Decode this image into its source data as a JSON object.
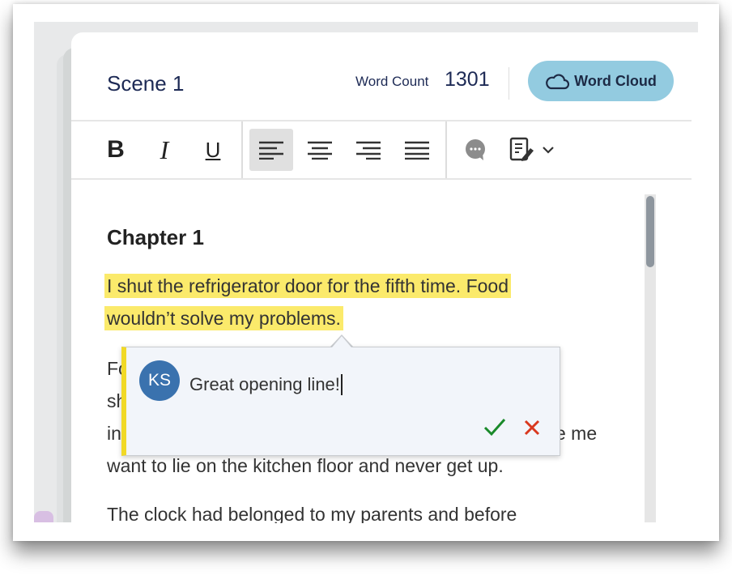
{
  "header": {
    "title": "Scene 1",
    "word_count_label": "Word Count",
    "word_count": "1301",
    "word_cloud_button": "Word Cloud"
  },
  "toolbar": {
    "buttons": [
      "bold-icon",
      "italic-icon",
      "underline-icon",
      "align-left-icon",
      "align-center-icon",
      "align-right-icon",
      "align-justify-icon",
      "comment-icon",
      "track-changes-icon",
      "chevron-down-icon"
    ],
    "active": "align-left"
  },
  "editor": {
    "heading": "Chapter 1",
    "highlighted_lines": [
      "I shut the refrigerator door for the fifth time. Food",
      "wouldn’t solve my problems."
    ],
    "para2_fragments": [
      "Fo",
      "sh",
      "in",
      "e me"
    ],
    "para2_last_line": "want to lie on the kitchen floor and never get up.",
    "para3_line": "The clock had belonged to my parents and before"
  },
  "comment_popup": {
    "avatar_initials": "KS",
    "text": "Great opening line!"
  },
  "colors": {
    "accent_button": "#93cbe0",
    "highlight": "#fbea6b",
    "comment_bar": "#f1d926",
    "avatar": "#3a72ae",
    "confirm": "#1a8a2a",
    "cancel": "#d9381e"
  }
}
